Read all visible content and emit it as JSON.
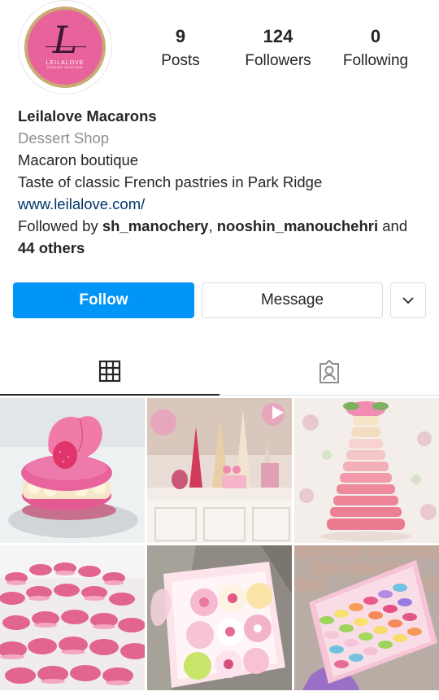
{
  "profile": {
    "posts": {
      "count": "9",
      "label": "Posts"
    },
    "followers": {
      "count": "124",
      "label": "Followers"
    },
    "following": {
      "count": "0",
      "label": "Following"
    },
    "avatar": {
      "letter": "L",
      "brand": "LEILALOVE",
      "tagline": "DESSERT BOUTIQUE"
    }
  },
  "bio": {
    "name": "Leilalove Macarons",
    "category": "Dessert Shop",
    "line1": "Macaron boutique",
    "line2": "Taste of classic French pastries in Park Ridge",
    "website": "www.leilalove.com/",
    "followed_prefix": "Followed by ",
    "follower1": "sh_manochery",
    "sep": ", ",
    "follower2": "nooshin_manouchehri",
    "and": " and",
    "others": "44 others"
  },
  "actions": {
    "follow": "Follow",
    "message": "Message",
    "more_icon": "chevron-down-icon"
  },
  "tabs": {
    "grid_icon": "grid-icon",
    "tagged_icon": "tagged-icon",
    "active": "grid"
  },
  "colors": {
    "accent": "#0095f6",
    "link": "#003569",
    "secondary_text": "#8e8e8e",
    "brand_pink": "#e8629b"
  },
  "posts": [
    {
      "subject": "rose-macaron",
      "type": "photo"
    },
    {
      "subject": "dessert-table",
      "type": "video"
    },
    {
      "subject": "macaron-tower",
      "type": "photo"
    },
    {
      "subject": "pink-macaron-pile",
      "type": "photo"
    },
    {
      "subject": "decorated-macaron-box",
      "type": "photo"
    },
    {
      "subject": "colorful-macaron-box",
      "type": "photo"
    }
  ]
}
